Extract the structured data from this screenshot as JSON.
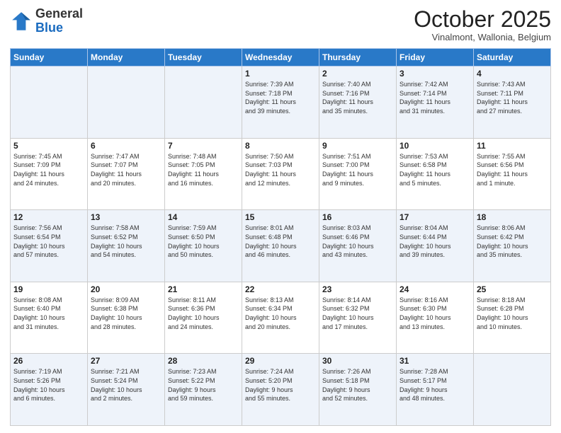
{
  "header": {
    "logo_general": "General",
    "logo_blue": "Blue",
    "month": "October 2025",
    "location": "Vinalmont, Wallonia, Belgium"
  },
  "weekdays": [
    "Sunday",
    "Monday",
    "Tuesday",
    "Wednesday",
    "Thursday",
    "Friday",
    "Saturday"
  ],
  "weeks": [
    [
      {
        "day": "",
        "info": ""
      },
      {
        "day": "",
        "info": ""
      },
      {
        "day": "",
        "info": ""
      },
      {
        "day": "1",
        "info": "Sunrise: 7:39 AM\nSunset: 7:18 PM\nDaylight: 11 hours\nand 39 minutes."
      },
      {
        "day": "2",
        "info": "Sunrise: 7:40 AM\nSunset: 7:16 PM\nDaylight: 11 hours\nand 35 minutes."
      },
      {
        "day": "3",
        "info": "Sunrise: 7:42 AM\nSunset: 7:14 PM\nDaylight: 11 hours\nand 31 minutes."
      },
      {
        "day": "4",
        "info": "Sunrise: 7:43 AM\nSunset: 7:11 PM\nDaylight: 11 hours\nand 27 minutes."
      }
    ],
    [
      {
        "day": "5",
        "info": "Sunrise: 7:45 AM\nSunset: 7:09 PM\nDaylight: 11 hours\nand 24 minutes."
      },
      {
        "day": "6",
        "info": "Sunrise: 7:47 AM\nSunset: 7:07 PM\nDaylight: 11 hours\nand 20 minutes."
      },
      {
        "day": "7",
        "info": "Sunrise: 7:48 AM\nSunset: 7:05 PM\nDaylight: 11 hours\nand 16 minutes."
      },
      {
        "day": "8",
        "info": "Sunrise: 7:50 AM\nSunset: 7:03 PM\nDaylight: 11 hours\nand 12 minutes."
      },
      {
        "day": "9",
        "info": "Sunrise: 7:51 AM\nSunset: 7:00 PM\nDaylight: 11 hours\nand 9 minutes."
      },
      {
        "day": "10",
        "info": "Sunrise: 7:53 AM\nSunset: 6:58 PM\nDaylight: 11 hours\nand 5 minutes."
      },
      {
        "day": "11",
        "info": "Sunrise: 7:55 AM\nSunset: 6:56 PM\nDaylight: 11 hours\nand 1 minute."
      }
    ],
    [
      {
        "day": "12",
        "info": "Sunrise: 7:56 AM\nSunset: 6:54 PM\nDaylight: 10 hours\nand 57 minutes."
      },
      {
        "day": "13",
        "info": "Sunrise: 7:58 AM\nSunset: 6:52 PM\nDaylight: 10 hours\nand 54 minutes."
      },
      {
        "day": "14",
        "info": "Sunrise: 7:59 AM\nSunset: 6:50 PM\nDaylight: 10 hours\nand 50 minutes."
      },
      {
        "day": "15",
        "info": "Sunrise: 8:01 AM\nSunset: 6:48 PM\nDaylight: 10 hours\nand 46 minutes."
      },
      {
        "day": "16",
        "info": "Sunrise: 8:03 AM\nSunset: 6:46 PM\nDaylight: 10 hours\nand 43 minutes."
      },
      {
        "day": "17",
        "info": "Sunrise: 8:04 AM\nSunset: 6:44 PM\nDaylight: 10 hours\nand 39 minutes."
      },
      {
        "day": "18",
        "info": "Sunrise: 8:06 AM\nSunset: 6:42 PM\nDaylight: 10 hours\nand 35 minutes."
      }
    ],
    [
      {
        "day": "19",
        "info": "Sunrise: 8:08 AM\nSunset: 6:40 PM\nDaylight: 10 hours\nand 31 minutes."
      },
      {
        "day": "20",
        "info": "Sunrise: 8:09 AM\nSunset: 6:38 PM\nDaylight: 10 hours\nand 28 minutes."
      },
      {
        "day": "21",
        "info": "Sunrise: 8:11 AM\nSunset: 6:36 PM\nDaylight: 10 hours\nand 24 minutes."
      },
      {
        "day": "22",
        "info": "Sunrise: 8:13 AM\nSunset: 6:34 PM\nDaylight: 10 hours\nand 20 minutes."
      },
      {
        "day": "23",
        "info": "Sunrise: 8:14 AM\nSunset: 6:32 PM\nDaylight: 10 hours\nand 17 minutes."
      },
      {
        "day": "24",
        "info": "Sunrise: 8:16 AM\nSunset: 6:30 PM\nDaylight: 10 hours\nand 13 minutes."
      },
      {
        "day": "25",
        "info": "Sunrise: 8:18 AM\nSunset: 6:28 PM\nDaylight: 10 hours\nand 10 minutes."
      }
    ],
    [
      {
        "day": "26",
        "info": "Sunrise: 7:19 AM\nSunset: 5:26 PM\nDaylight: 10 hours\nand 6 minutes."
      },
      {
        "day": "27",
        "info": "Sunrise: 7:21 AM\nSunset: 5:24 PM\nDaylight: 10 hours\nand 2 minutes."
      },
      {
        "day": "28",
        "info": "Sunrise: 7:23 AM\nSunset: 5:22 PM\nDaylight: 9 hours\nand 59 minutes."
      },
      {
        "day": "29",
        "info": "Sunrise: 7:24 AM\nSunset: 5:20 PM\nDaylight: 9 hours\nand 55 minutes."
      },
      {
        "day": "30",
        "info": "Sunrise: 7:26 AM\nSunset: 5:18 PM\nDaylight: 9 hours\nand 52 minutes."
      },
      {
        "day": "31",
        "info": "Sunrise: 7:28 AM\nSunset: 5:17 PM\nDaylight: 9 hours\nand 48 minutes."
      },
      {
        "day": "",
        "info": ""
      }
    ]
  ]
}
